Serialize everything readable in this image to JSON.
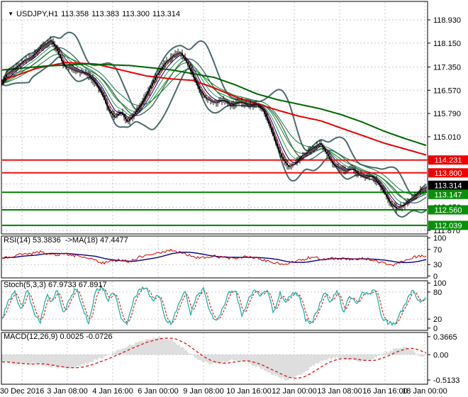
{
  "title": {
    "dropdown_icon": "▼",
    "symbol": "USDJPY,H1",
    "open": "113.358",
    "high": "113.383",
    "low": "113.300",
    "close": "113.314"
  },
  "panels": {
    "rsi_label": "RSI(14) 53.3836  ->MA(18) 47.4477",
    "stoch_label": "Stoch(5,3,3) 67.9733 67.8917",
    "macd_label": "MACD(12,26,9) 0.0025 -0.0726"
  },
  "colors": {
    "background": "#ffffff",
    "border": "#000000",
    "grid": "#c9c9c9",
    "bar": "#000000",
    "bands": "#4a6a6a",
    "ma_red": "#e60000",
    "ma_green": "#006400",
    "ema_red": "#cc2222",
    "ema_navy": "#000080",
    "ema_green1": "#2e9e4f",
    "ema_green2": "#168c16",
    "ema_green3": "#0a7a3c",
    "level_red": "#ee1111",
    "level_green": "#008000",
    "box_red": "#f00000",
    "box_green": "#0a8f0a",
    "box_black": "#000000",
    "box_text": "#ffffff",
    "axis_text": "#000000",
    "rsi": "#cc0000",
    "rsi_ma": "#000080",
    "stoch": "#20b2aa",
    "signal_red": "#dd1111",
    "macd_hist": "#bdbdbd"
  },
  "chart_data": [
    {
      "type": "candlestick",
      "symbol": "USDJPY",
      "timeframe": "H1",
      "title": "USDJPY,H1 113.358 113.383 113.300 113.314",
      "x_labels": [
        "30 Dec 2016",
        "3 Jan 08:00",
        "4 Jan 16:00",
        "6 Jan 00:00",
        "9 Jan 08:00",
        "10 Jan 16:00",
        "12 Jan 00:00",
        "13 Jan 08:00",
        "16 Jan 16:00",
        "18 Jan 00:00"
      ],
      "y_axis_ticks": [
        118.93,
        118.15,
        117.35,
        116.57,
        115.79,
        115.01,
        114.23,
        113.43,
        112.65,
        111.87
      ],
      "ylim": [
        111.75,
        119.55
      ],
      "grid": true,
      "current_price": 113.314,
      "price_boxes": [
        {
          "label": "114.231",
          "value": 114.231,
          "role": "resistance",
          "bg": "box_red"
        },
        {
          "label": "113.800",
          "value": 113.8,
          "role": "resistance",
          "bg": "box_red"
        },
        {
          "label": "113.314",
          "value": 113.314,
          "role": "current-price",
          "bg": "box_black"
        },
        {
          "label": "113.147",
          "value": 113.147,
          "role": "support",
          "bg": "box_green"
        },
        {
          "label": "112.560",
          "value": 112.56,
          "role": "support",
          "bg": "box_green"
        },
        {
          "label": "112.039",
          "value": 112.039,
          "role": "support",
          "bg": "box_green"
        }
      ],
      "level_lines": [
        {
          "value": 114.231,
          "role": "resistance",
          "color": "level_red"
        },
        {
          "value": 113.8,
          "role": "resistance",
          "color": "level_red"
        },
        {
          "value": 113.147,
          "role": "support",
          "color": "level_green"
        },
        {
          "value": 112.56,
          "role": "support",
          "color": "level_green"
        },
        {
          "value": 112.039,
          "role": "support",
          "color": "level_green"
        }
      ],
      "close_keyframes": [
        [
          0,
          116.8
        ],
        [
          0.01,
          117.1
        ],
        [
          0.03,
          117.3
        ],
        [
          0.05,
          117.55
        ],
        [
          0.07,
          117.7
        ],
        [
          0.09,
          118.0
        ],
        [
          0.105,
          118.15
        ],
        [
          0.115,
          118.25
        ],
        [
          0.13,
          117.9
        ],
        [
          0.145,
          117.4
        ],
        [
          0.16,
          117.3
        ],
        [
          0.175,
          117.2
        ],
        [
          0.19,
          117.15
        ],
        [
          0.205,
          117.05
        ],
        [
          0.22,
          116.8
        ],
        [
          0.235,
          116.45
        ],
        [
          0.25,
          115.95
        ],
        [
          0.265,
          115.65
        ],
        [
          0.28,
          115.85
        ],
        [
          0.295,
          115.5
        ],
        [
          0.31,
          115.75
        ],
        [
          0.325,
          116.05
        ],
        [
          0.345,
          116.55
        ],
        [
          0.365,
          117.1
        ],
        [
          0.385,
          117.5
        ],
        [
          0.405,
          117.75
        ],
        [
          0.42,
          117.85
        ],
        [
          0.435,
          117.5
        ],
        [
          0.45,
          117.05
        ],
        [
          0.465,
          116.6
        ],
        [
          0.48,
          116.3
        ],
        [
          0.5,
          116.15
        ],
        [
          0.52,
          116.25
        ],
        [
          0.54,
          116.05
        ],
        [
          0.56,
          116.2
        ],
        [
          0.58,
          116.05
        ],
        [
          0.6,
          116.1
        ],
        [
          0.615,
          115.9
        ],
        [
          0.63,
          115.4
        ],
        [
          0.645,
          114.8
        ],
        [
          0.66,
          114.3
        ],
        [
          0.675,
          114.0
        ],
        [
          0.69,
          114.1
        ],
        [
          0.705,
          114.35
        ],
        [
          0.72,
          114.5
        ],
        [
          0.735,
          114.65
        ],
        [
          0.75,
          114.8
        ],
        [
          0.765,
          114.45
        ],
        [
          0.78,
          114.1
        ],
        [
          0.795,
          113.95
        ],
        [
          0.81,
          113.85
        ],
        [
          0.825,
          113.95
        ],
        [
          0.84,
          113.75
        ],
        [
          0.855,
          113.65
        ],
        [
          0.87,
          113.7
        ],
        [
          0.885,
          113.5
        ],
        [
          0.9,
          113.15
        ],
        [
          0.915,
          112.8
        ],
        [
          0.93,
          112.6
        ],
        [
          0.945,
          112.7
        ],
        [
          0.96,
          112.9
        ],
        [
          0.975,
          113.05
        ],
        [
          0.99,
          113.25
        ],
        [
          1,
          113.314
        ]
      ],
      "ma_red_keyframes": [
        [
          0,
          116.9
        ],
        [
          0.08,
          117.3
        ],
        [
          0.15,
          117.5
        ],
        [
          0.22,
          117.45
        ],
        [
          0.28,
          117.25
        ],
        [
          0.34,
          117.05
        ],
        [
          0.4,
          116.95
        ],
        [
          0.45,
          116.9
        ],
        [
          0.5,
          116.65
        ],
        [
          0.55,
          116.35
        ],
        [
          0.6,
          116.12
        ],
        [
          0.65,
          115.9
        ],
        [
          0.7,
          115.7
        ],
        [
          0.75,
          115.55
        ],
        [
          0.8,
          115.3
        ],
        [
          0.85,
          115.05
        ],
        [
          0.9,
          114.8
        ],
        [
          0.95,
          114.6
        ],
        [
          1,
          114.4
        ]
      ],
      "ma_green_keyframes": [
        [
          0,
          117.25
        ],
        [
          0.1,
          117.38
        ],
        [
          0.2,
          117.45
        ],
        [
          0.3,
          117.4
        ],
        [
          0.4,
          117.25
        ],
        [
          0.5,
          117.0
        ],
        [
          0.55,
          116.75
        ],
        [
          0.6,
          116.45
        ],
        [
          0.65,
          116.25
        ],
        [
          0.7,
          116.1
        ],
        [
          0.75,
          115.95
        ],
        [
          0.8,
          115.75
        ],
        [
          0.85,
          115.5
        ],
        [
          0.9,
          115.2
        ],
        [
          0.95,
          114.95
        ],
        [
          1,
          114.72
        ]
      ]
    },
    {
      "type": "line",
      "name": "RSI",
      "params": "(14)",
      "value": 53.3836,
      "ma_value": 47.4477,
      "y_ticks": [
        100,
        70,
        30,
        0
      ],
      "levels": [
        70,
        30
      ],
      "ylim": [
        0,
        100
      ],
      "keyframes": [
        [
          0,
          47
        ],
        [
          0.03,
          54
        ],
        [
          0.06,
          58
        ],
        [
          0.09,
          63
        ],
        [
          0.12,
          55
        ],
        [
          0.15,
          58
        ],
        [
          0.18,
          52
        ],
        [
          0.21,
          44
        ],
        [
          0.24,
          34
        ],
        [
          0.27,
          42
        ],
        [
          0.3,
          38
        ],
        [
          0.33,
          52
        ],
        [
          0.36,
          60
        ],
        [
          0.4,
          68
        ],
        [
          0.43,
          58
        ],
        [
          0.46,
          48
        ],
        [
          0.5,
          52
        ],
        [
          0.54,
          46
        ],
        [
          0.58,
          52
        ],
        [
          0.61,
          44
        ],
        [
          0.64,
          36
        ],
        [
          0.67,
          31
        ],
        [
          0.7,
          40
        ],
        [
          0.73,
          50
        ],
        [
          0.76,
          44
        ],
        [
          0.79,
          47
        ],
        [
          0.82,
          44
        ],
        [
          0.85,
          47
        ],
        [
          0.88,
          41
        ],
        [
          0.9,
          34
        ],
        [
          0.925,
          29
        ],
        [
          0.95,
          40
        ],
        [
          0.97,
          50
        ],
        [
          1,
          53.4
        ]
      ]
    },
    {
      "type": "line",
      "name": "Stochastic",
      "params": "(5,3,3)",
      "value": 67.9733,
      "signal_value": 67.8917,
      "y_ticks": [
        100,
        80,
        20,
        0
      ],
      "levels": [
        80,
        20
      ],
      "ylim": [
        0,
        100
      ],
      "keyframes": [
        [
          0,
          22
        ],
        [
          0.015,
          60
        ],
        [
          0.03,
          80
        ],
        [
          0.045,
          38
        ],
        [
          0.06,
          88
        ],
        [
          0.075,
          30
        ],
        [
          0.09,
          14
        ],
        [
          0.105,
          75
        ],
        [
          0.115,
          55
        ],
        [
          0.13,
          85
        ],
        [
          0.145,
          28
        ],
        [
          0.16,
          68
        ],
        [
          0.175,
          90
        ],
        [
          0.19,
          40
        ],
        [
          0.205,
          12
        ],
        [
          0.22,
          80
        ],
        [
          0.235,
          93
        ],
        [
          0.25,
          62
        ],
        [
          0.265,
          82
        ],
        [
          0.28,
          24
        ],
        [
          0.295,
          10
        ],
        [
          0.31,
          65
        ],
        [
          0.325,
          86
        ],
        [
          0.34,
          90
        ],
        [
          0.355,
          58
        ],
        [
          0.37,
          76
        ],
        [
          0.385,
          18
        ],
        [
          0.4,
          10
        ],
        [
          0.415,
          52
        ],
        [
          0.43,
          84
        ],
        [
          0.445,
          32
        ],
        [
          0.46,
          72
        ],
        [
          0.475,
          86
        ],
        [
          0.49,
          38
        ],
        [
          0.505,
          14
        ],
        [
          0.52,
          44
        ],
        [
          0.535,
          78
        ],
        [
          0.55,
          86
        ],
        [
          0.565,
          28
        ],
        [
          0.58,
          62
        ],
        [
          0.595,
          88
        ],
        [
          0.61,
          70
        ],
        [
          0.625,
          84
        ],
        [
          0.64,
          32
        ],
        [
          0.655,
          78
        ],
        [
          0.67,
          55
        ],
        [
          0.685,
          82
        ],
        [
          0.7,
          72
        ],
        [
          0.715,
          20
        ],
        [
          0.73,
          12
        ],
        [
          0.745,
          42
        ],
        [
          0.76,
          82
        ],
        [
          0.775,
          58
        ],
        [
          0.79,
          86
        ],
        [
          0.805,
          35
        ],
        [
          0.82,
          75
        ],
        [
          0.835,
          52
        ],
        [
          0.85,
          82
        ],
        [
          0.865,
          72
        ],
        [
          0.88,
          86
        ],
        [
          0.895,
          25
        ],
        [
          0.91,
          12
        ],
        [
          0.925,
          8
        ],
        [
          0.94,
          35
        ],
        [
          0.955,
          62
        ],
        [
          0.97,
          85
        ],
        [
          0.985,
          55
        ],
        [
          1,
          68
        ]
      ]
    },
    {
      "type": "bar",
      "name": "MACD",
      "params": "(12,26,9)",
      "value": 0.0025,
      "signal_value": -0.0726,
      "y_ticks": [
        {
          "label": "0.3665",
          "value": 0.3665
        },
        {
          "label": "0.00",
          "value": 0
        },
        {
          "label": "-0.5133",
          "value": -0.5133
        }
      ],
      "ylim": [
        -0.6,
        0.45
      ],
      "keyframes": [
        [
          0,
          -0.15
        ],
        [
          0.04,
          -0.2
        ],
        [
          0.08,
          -0.18
        ],
        [
          0.12,
          -0.25
        ],
        [
          0.16,
          -0.27
        ],
        [
          0.2,
          -0.18
        ],
        [
          0.24,
          -0.05
        ],
        [
          0.28,
          0.12
        ],
        [
          0.31,
          0.22
        ],
        [
          0.34,
          0.3
        ],
        [
          0.37,
          0.365
        ],
        [
          0.4,
          0.3
        ],
        [
          0.43,
          0.12
        ],
        [
          0.46,
          -0.08
        ],
        [
          0.49,
          -0.2
        ],
        [
          0.52,
          -0.16
        ],
        [
          0.55,
          -0.1
        ],
        [
          0.58,
          -0.16
        ],
        [
          0.61,
          -0.28
        ],
        [
          0.64,
          -0.4
        ],
        [
          0.67,
          -0.51
        ],
        [
          0.7,
          -0.42
        ],
        [
          0.73,
          -0.25
        ],
        [
          0.76,
          -0.1
        ],
        [
          0.79,
          -0.06
        ],
        [
          0.82,
          -0.1
        ],
        [
          0.85,
          -0.14
        ],
        [
          0.88,
          -0.06
        ],
        [
          0.91,
          0.06
        ],
        [
          0.93,
          0.13
        ],
        [
          0.95,
          0.15
        ],
        [
          0.97,
          0.06
        ],
        [
          0.99,
          -0.03
        ],
        [
          1,
          0.0
        ]
      ]
    }
  ]
}
